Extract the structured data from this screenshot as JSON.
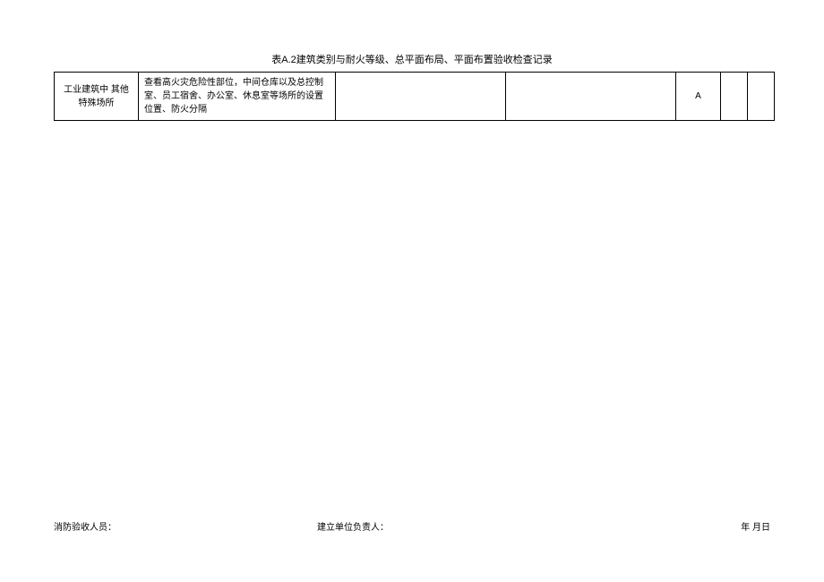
{
  "title": "表A.2建筑类别与耐火等级、总平面布局、平面布置验收检查记录",
  "row": {
    "category": "工业建筑中 其他特殊场所",
    "content": "查看高火灾危险性部位，中间仓库以及总控制 室、员工宿舍、办公室、休息室等场所的设置 位置、防火分隔",
    "col3": "",
    "col4": "",
    "level": "A",
    "col6": "",
    "col7": ""
  },
  "footer": {
    "left_label": "消防验收人员：",
    "center_label": "建立单位负责人：",
    "right_label": "年 月日"
  }
}
